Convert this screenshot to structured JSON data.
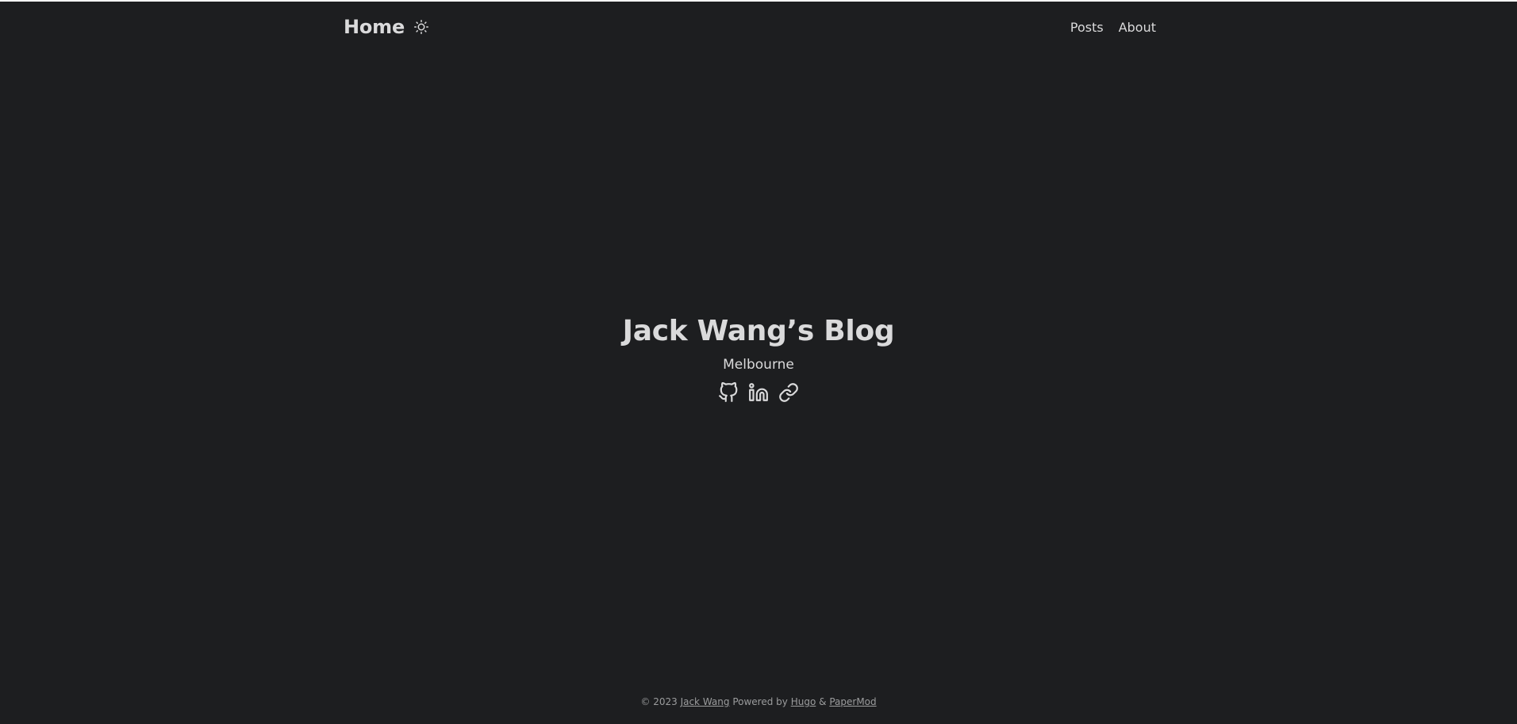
{
  "header": {
    "logo_label": "Home",
    "theme_toggle_icon": "sun-icon",
    "menu": [
      {
        "label": "Posts"
      },
      {
        "label": "About"
      }
    ]
  },
  "hero": {
    "title": "Jack Wang’s Blog",
    "subtitle": "Melbourne",
    "social_icons": [
      "github-icon",
      "linkedin-icon",
      "link-icon"
    ]
  },
  "footer": {
    "copyright_prefix": "© 2023",
    "author": "Jack Wang",
    "powered_by_text": "Powered by",
    "hugo_label": "Hugo",
    "ampersand": "&",
    "papermod_label": "PaperMod"
  },
  "colors": {
    "background": "#1d1e20",
    "primary_text": "#dadadb",
    "secondary_text": "#9b9c9d"
  }
}
